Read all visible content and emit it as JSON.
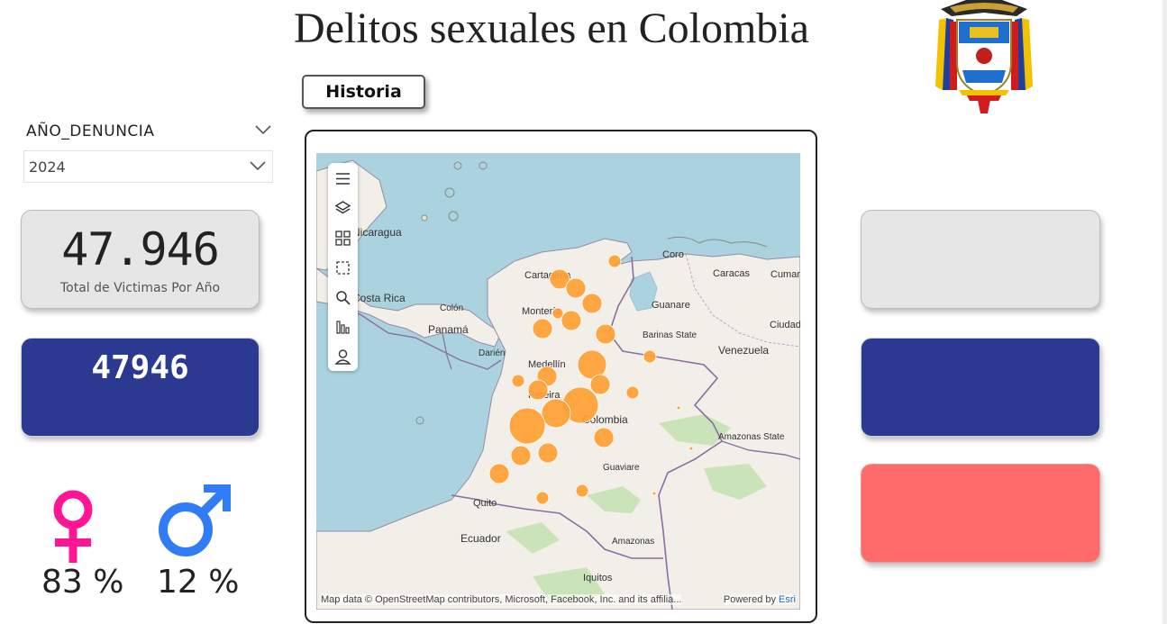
{
  "header": {
    "title": "Delitos sexuales en Colombia"
  },
  "nav": {
    "history_button": "Historia"
  },
  "slicer": {
    "title": "AÑO_DENUNCIA",
    "selected": "2024"
  },
  "kpis": {
    "total_value": "47.946",
    "total_label": "Total de Victimas Por Año",
    "count_value": "47946"
  },
  "gender": {
    "female_pct": "83 %",
    "male_pct": "12 %"
  },
  "map": {
    "labels": {
      "cartagena": "Cartagena",
      "coro": "Coro",
      "caracas": "Caracas",
      "cumana": "Cumaná",
      "guanare": "Guanare",
      "ciudad": "Ciudad",
      "monteria": "Montería",
      "panama": "Panamá",
      "colon": "Colón",
      "darien": "Darién",
      "barinas": "Barinas State",
      "venezuela": "Venezuela",
      "medellin": "Medellín",
      "pereira": "Pereira",
      "colombia": "Colombia",
      "amazonas_state": "Amazonas State",
      "guaviare": "Guaviare",
      "quito": "Quito",
      "ecuador": "Ecuador",
      "amazonas": "Amazonas",
      "iquitos": "Iquitos",
      "costa_rica": "Costa Rica",
      "nicaragua": "Nicaragua"
    },
    "attribution": "Map data © OpenStreetMap contributors, Microsoft, Facebook, Inc. and its affilia...",
    "powered_by": "Powered by",
    "esri": "Esri"
  },
  "colors": {
    "navy": "#2b3990",
    "coral": "#ff6b6b",
    "female": "#ff1493",
    "male": "#2f7cf6",
    "bubble": "#ffa033",
    "water": "#aad3df",
    "land": "#f2efe9"
  },
  "icons": [
    "female-symbol-icon",
    "male-symbol-icon",
    "chevron-down-icon",
    "menu-icon",
    "layers-icon",
    "qr-icon",
    "selection-icon",
    "search-icon",
    "bar-icon",
    "person-icon",
    "coat-of-arms"
  ]
}
